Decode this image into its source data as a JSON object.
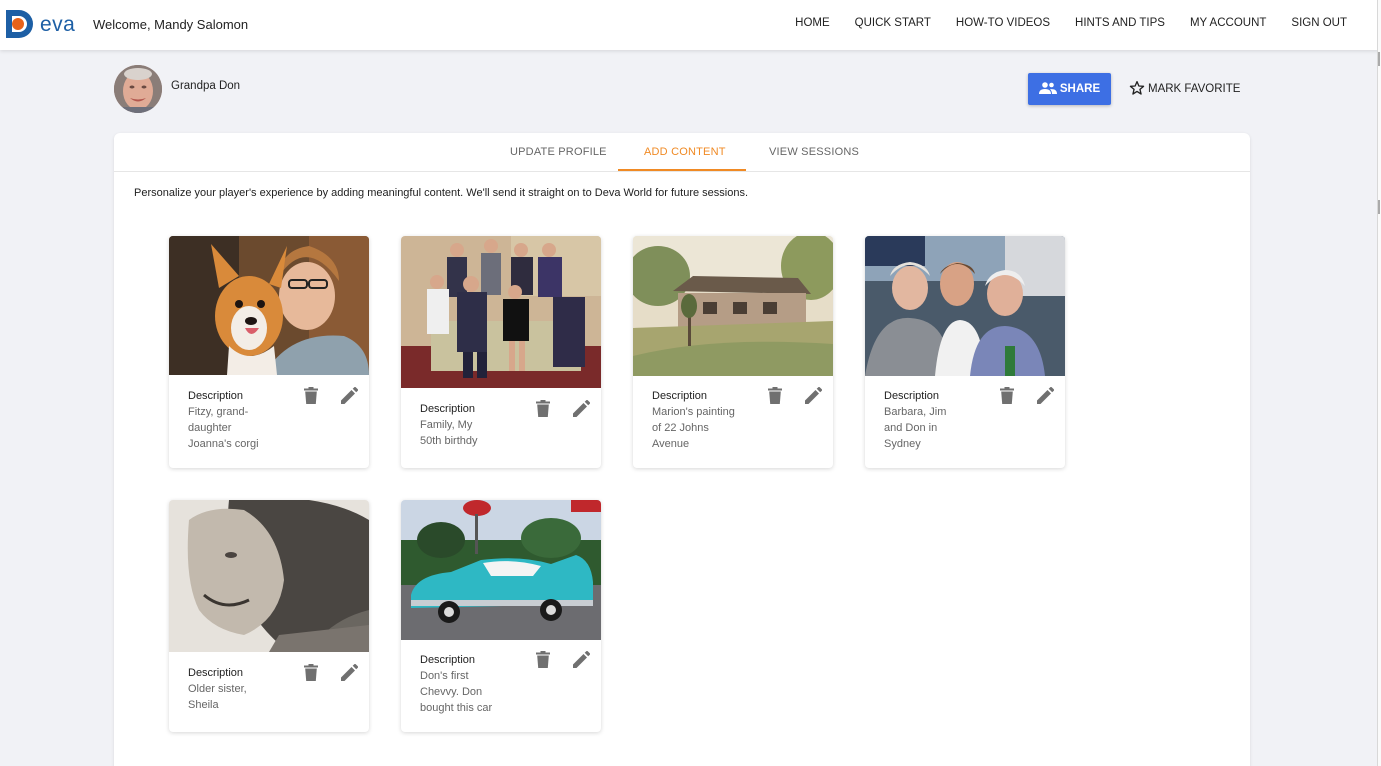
{
  "app": {
    "logo_text": "eva",
    "brand_color": "#1d5fa5",
    "accent_orange": "#f08a24",
    "primary_blue": "#3d6fe4"
  },
  "header": {
    "welcome": "Welcome, Mandy Salomon",
    "nav": [
      "HOME",
      "QUICK START",
      "HOW-TO VIDEOS",
      "HINTS AND TIPS",
      "MY ACCOUNT",
      "SIGN OUT"
    ]
  },
  "profile": {
    "name": "Grandpa Don",
    "share_label": "SHARE",
    "favorite_label": "MARK FAVORITE"
  },
  "tabs": {
    "items": [
      "UPDATE PROFILE",
      "ADD CONTENT",
      "VIEW SESSIONS"
    ],
    "active": "ADD CONTENT"
  },
  "intro": "Personalize your player's experience by adding meaningful content. We'll send it straight on to Deva World for future sessions.",
  "content": [
    {
      "label": "Description",
      "text": "Fitzy, grand-daughter Joanna's corgi",
      "image": "woman-with-corgi-photo"
    },
    {
      "label": "Description",
      "text": "Family, My 50th birthdy",
      "image": "family-portrait-photo"
    },
    {
      "label": "Description",
      "text": "Marion's painting of 22 Johns Avenue",
      "image": "house-watercolor-painting"
    },
    {
      "label": "Description",
      "text": "Barbara, Jim and Don in Sydney",
      "image": "three-people-selfie-photo"
    },
    {
      "label": "Description",
      "text": "Older sister, Sheila",
      "image": "woman-portrait-bw-photo"
    },
    {
      "label": "Description",
      "text": "Don's first Chevvy. Don bought this car",
      "image": "turquoise-chevy-car-photo"
    }
  ],
  "icons": {
    "delete": "trash-icon",
    "edit": "pencil-icon",
    "share": "people-icon",
    "favorite": "star-outline-icon"
  }
}
